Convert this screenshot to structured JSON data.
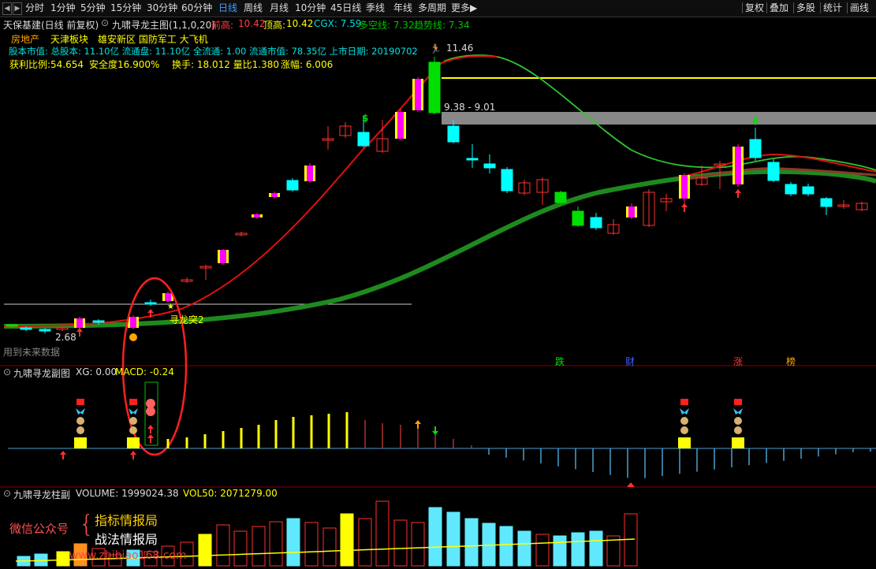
{
  "toolbar": {
    "periods": [
      "分时",
      "1分钟",
      "5分钟",
      "15分钟",
      "30分钟",
      "60分钟",
      "日线",
      "周线",
      "月线",
      "10分钟",
      "45日线",
      "季线",
      "年线",
      "多周期",
      "更多"
    ],
    "active_period": "日线",
    "right_buttons": [
      "复权",
      "叠加",
      "多股",
      "统计",
      "画线"
    ]
  },
  "header": {
    "stock": "天保基建(日线 前复权)",
    "indicator": "九啸寻龙主图(1,1,0,20)",
    "prev_high_label": "前高:",
    "prev_high": "10.42",
    "top_high_label": "顶高:",
    "top_high": "10.42",
    "cgx": "CGX: 7.59",
    "multi_empty": "多空线: 7.32",
    "trend": "趋势线: 7.34"
  },
  "info": {
    "concepts": [
      "房地产",
      "天津板块",
      "雄安新区 国防军工 大飞机"
    ],
    "capital": "股本市值: 总股本: 11.10亿 流通盘: 11.10亿 全流通: 1.00 流通市值: 78.35亿 上市日期: 20190702",
    "profit": "获利比例:54.654",
    "safety": "安全度16.900%",
    "turnover": "换手: 18.012 量比1.380",
    "amplitude": "涨幅: 6.006"
  },
  "main_chart": {
    "price_high_label": "11.46",
    "price_low_label": "2.68",
    "band_label": "9.38 - 9.01",
    "signal_label": "寻龙突2",
    "future_label": "用到未来数据",
    "marker_labels": [
      "跌",
      "财",
      "涨",
      "榜"
    ],
    "dollar": "$"
  },
  "macd_panel": {
    "title": "九啸寻龙副图",
    "xg": "XG: 0.00",
    "macd": "MACD: -0.24"
  },
  "volume_panel": {
    "title": "九啸寻龙柱副",
    "volume": "VOLUME: 1999024.38",
    "vol50": "VOL50: 2071279.00"
  },
  "watermark": {
    "left": "微信公众号",
    "brace": "{",
    "line1": "指标情报局",
    "line2": "战法情报局",
    "site": "www.zhibiao168.com"
  },
  "colors": {
    "up": "#ff3030",
    "up_body": "#ff00ff",
    "down": "#00ffff",
    "green": "#00e000",
    "yellow": "#ffff00",
    "ma_red": "#e01010",
    "ma_green": "#1e8a1e"
  }
}
